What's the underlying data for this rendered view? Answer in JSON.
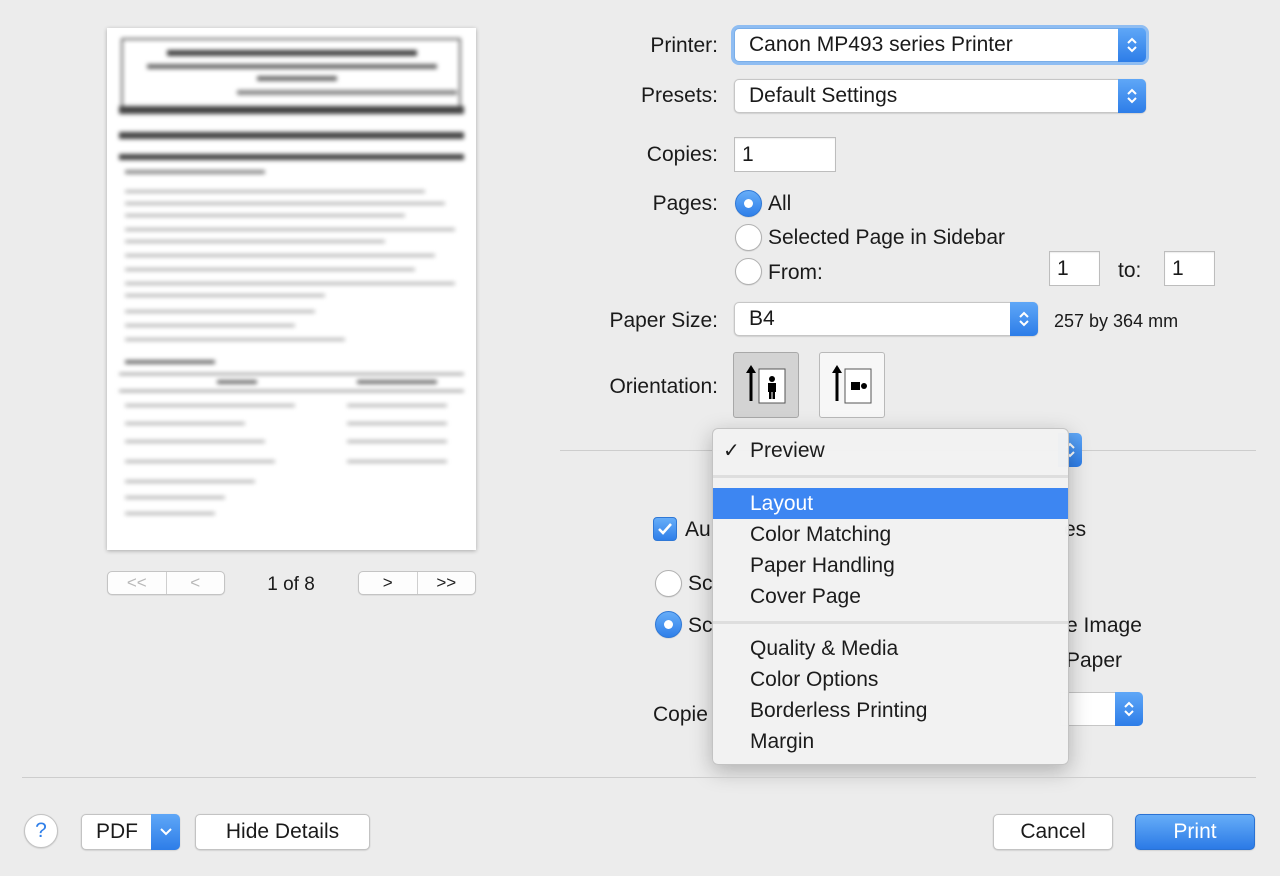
{
  "preview": {
    "page_indicator": "1 of 8",
    "nav": {
      "first": "<<",
      "prev": "<",
      "next": ">",
      "last": ">>"
    }
  },
  "form": {
    "printer": {
      "label": "Printer:",
      "value": "Canon MP493 series Printer"
    },
    "presets": {
      "label": "Presets:",
      "value": "Default Settings"
    },
    "copies": {
      "label": "Copies:",
      "value": "1"
    },
    "pages": {
      "label": "Pages:",
      "options": {
        "all": "All",
        "selected": "Selected Page in Sidebar",
        "from": "From:"
      },
      "selected_option": "All",
      "from_value": "1",
      "to_label": "to:",
      "to_value": "1"
    },
    "paper_size": {
      "label": "Paper Size:",
      "value": "B4",
      "dimensions": "257 by 364 mm"
    },
    "orientation": {
      "label": "Orientation:",
      "selected": "portrait"
    }
  },
  "section_menu": {
    "checked_item": "Preview",
    "highlighted_item": "Layout",
    "groups": [
      [
        "Preview"
      ],
      [
        "Layout",
        "Color Matching",
        "Paper Handling",
        "Cover Page"
      ],
      [
        "Quality & Media",
        "Color Options",
        "Borderless Printing",
        "Margin"
      ]
    ]
  },
  "behind_menu": {
    "auto_fragment": "Au",
    "auto_end_fragment": "es",
    "scale_fragment_1": "Sc",
    "scale_fragment_2": "Sc",
    "image_fragment": "e Image",
    "paper_fragment": "Paper",
    "copies_fragment": "Copie"
  },
  "footer": {
    "help": "?",
    "pdf": "PDF",
    "hide_details": "Hide Details",
    "cancel": "Cancel",
    "print": "Print"
  },
  "colors": {
    "accent": "#3d86f2",
    "window_bg": "#ececec"
  }
}
